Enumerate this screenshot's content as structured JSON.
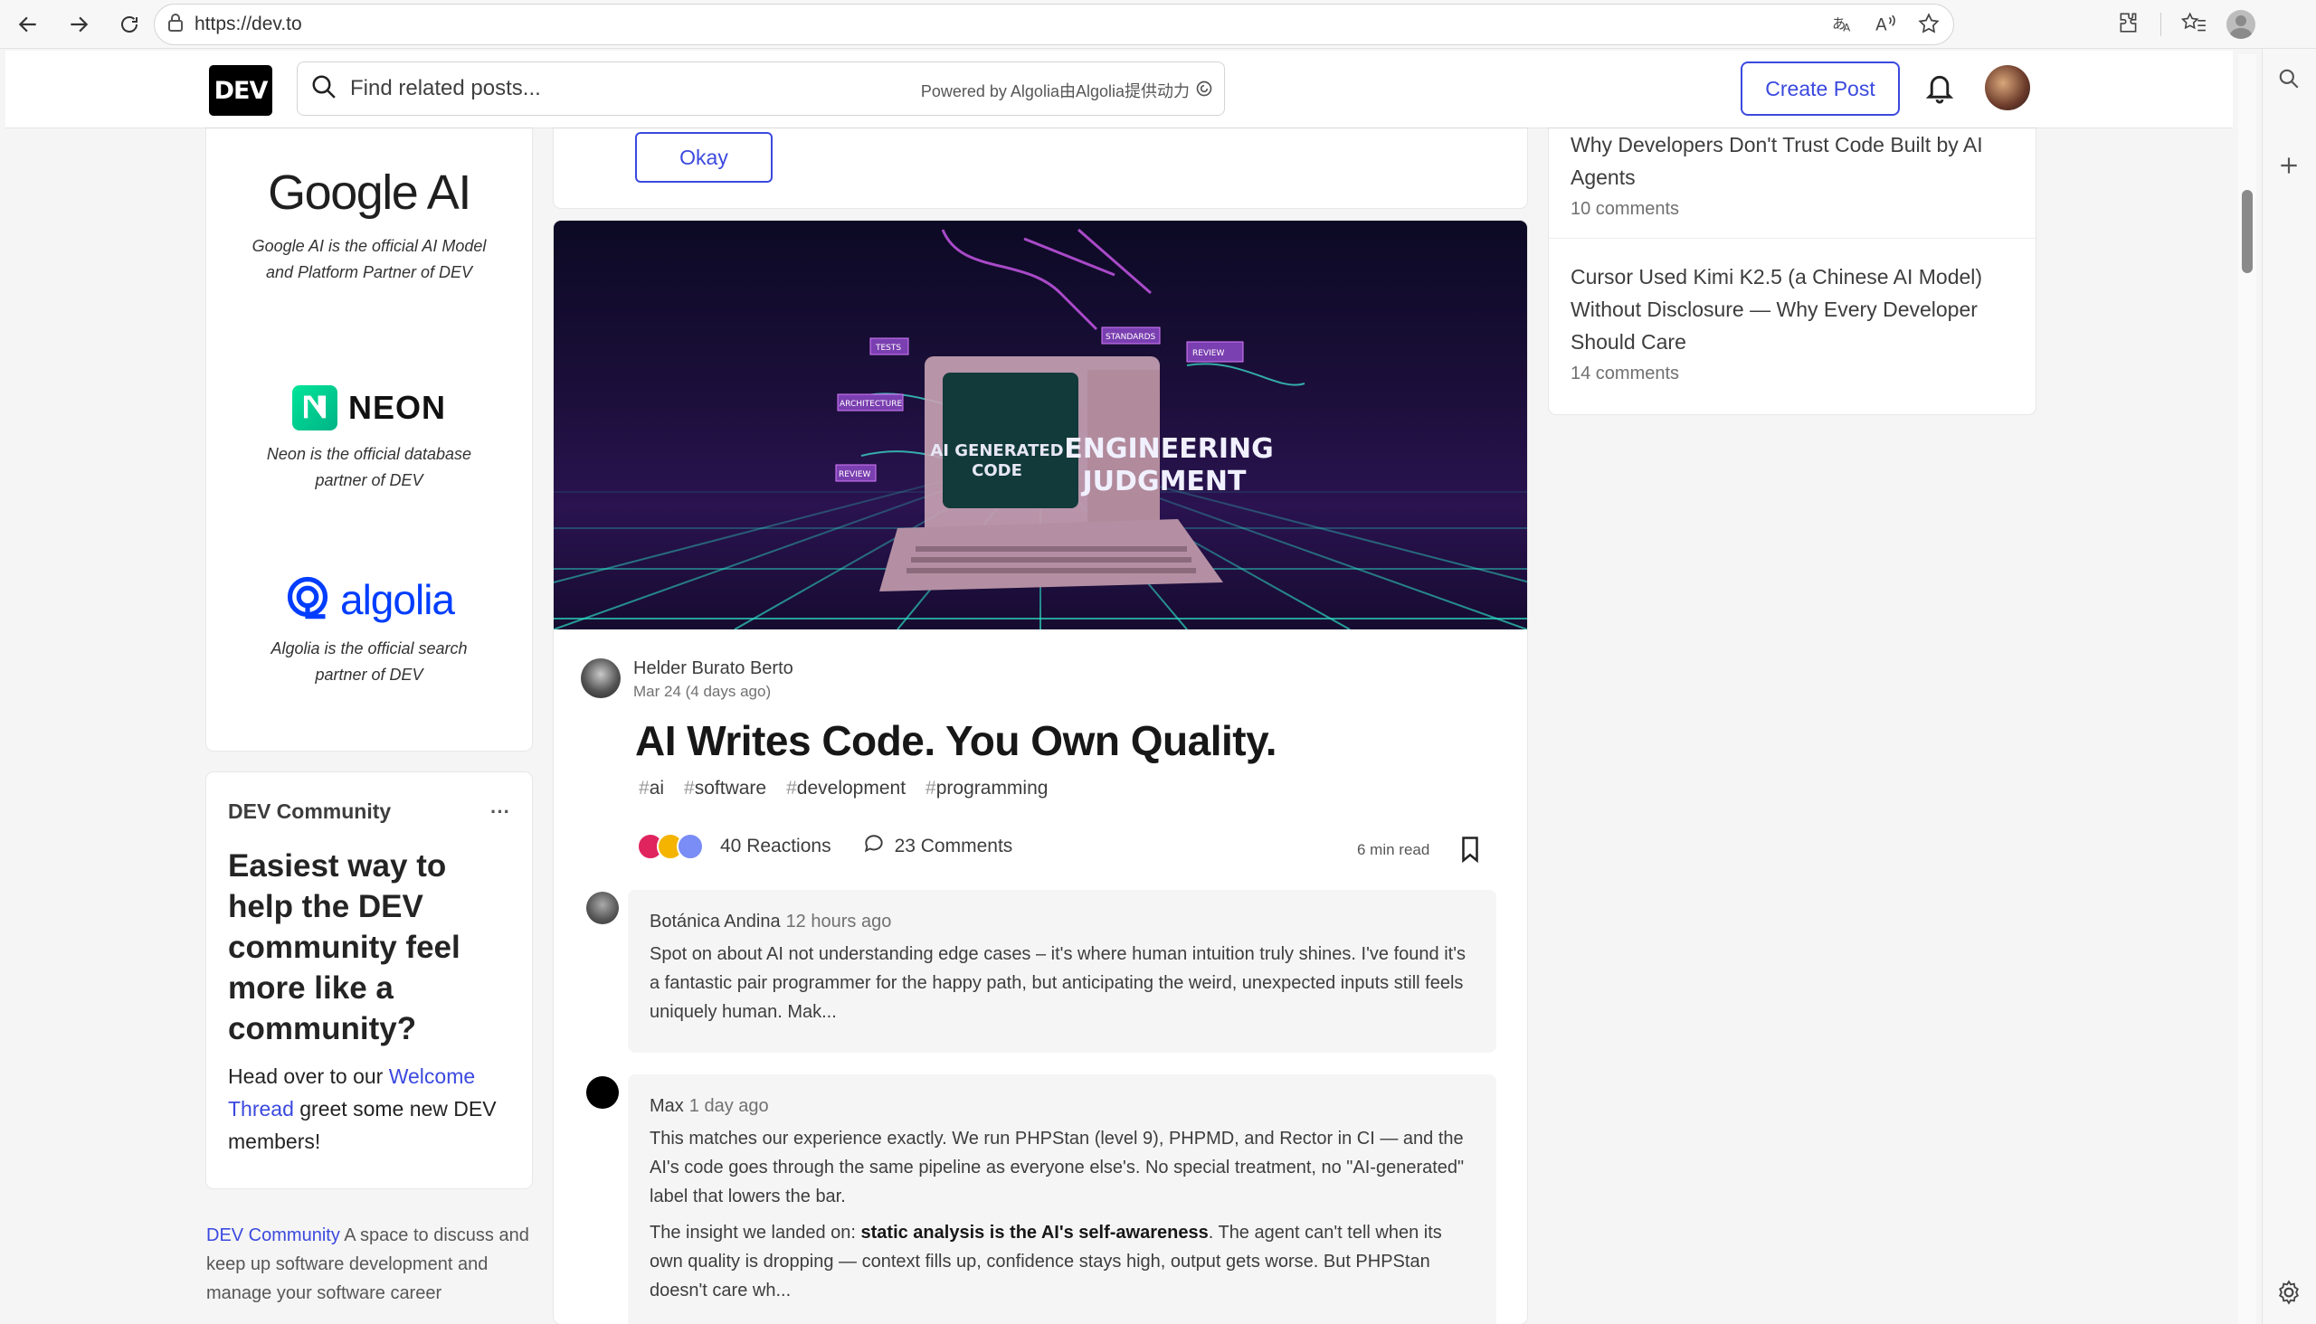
{
  "browser": {
    "url": "https://dev.to"
  },
  "header": {
    "logo": "DEV",
    "search_placeholder": "Find related posts...",
    "powered_by": "Powered by Algolia由Algolia提供动力",
    "create_post": "Create Post"
  },
  "sponsors": [
    {
      "name": "Google AI",
      "desc": "Google AI is the official AI Model and Platform Partner of DEV"
    },
    {
      "name": "NEON",
      "desc": "Neon is the official database partner of DEV"
    },
    {
      "name": "algolia",
      "desc": "Algolia is the official search partner of DEV"
    }
  ],
  "welcome": {
    "community": "DEV Community",
    "more": "···",
    "heading": "Easiest way to help the DEV community feel more like a community?",
    "text_before": "Head over to our",
    "link": "Welcome Thread",
    "text_after": "greet some new DEV members!"
  },
  "footer": {
    "link": "DEV Community",
    "text": "A space to discuss and keep up software development and manage your software career"
  },
  "okay_button": "Okay",
  "post": {
    "cover": {
      "line1": "ENGINEERING",
      "line2": "JUDGMENT",
      "screen1": "AI GENERATED",
      "screen2": "CODE",
      "tags": [
        "TESTS",
        "STANDARDS",
        "REVIEW",
        "ARCHITECTURE",
        "REVIEW"
      ]
    },
    "author": "Helder Burato Berto",
    "date": "Mar 24 (4 days ago)",
    "title": "AI Writes Code. You Own Quality.",
    "tags": [
      "ai",
      "software",
      "development",
      "programming"
    ],
    "reactions": "40 Reactions",
    "comments": "23 Comments",
    "read_time": "6 min read"
  },
  "comments": [
    {
      "author": "Botánica Andina",
      "time": "12 hours ago",
      "text": "Spot on about AI not understanding edge cases – it's where human intuition truly shines. I've found it's a fantastic pair programmer for the happy path, but anticipating the weird, unexpected inputs still feels uniquely human. Mak..."
    },
    {
      "author": "Max",
      "time": "1 day ago",
      "text": "This matches our experience exactly. We run PHPStan (level 9), PHPMD, and Rector in CI — and the AI's code goes through the same pipeline as everyone else's. No special treatment, no \"AI-generated\" label that lowers the bar.",
      "text2_before": "The insight we landed on:",
      "text2_bold": "static analysis is the AI's self-awareness",
      "text2_after": ". The agent can't tell when its own quality is dropping — context fills up, confidence stays high, output gets worse. But PHPStan doesn't care wh..."
    }
  ],
  "right_sidebar": [
    {
      "title": "Why Developers Don't Trust Code Built by AI Agents",
      "comments": "10 comments"
    },
    {
      "title": "Cursor Used Kimi K2.5 (a Chinese AI Model) Without Disclosure — Why Every Developer Should Care",
      "comments": "14 comments"
    }
  ]
}
